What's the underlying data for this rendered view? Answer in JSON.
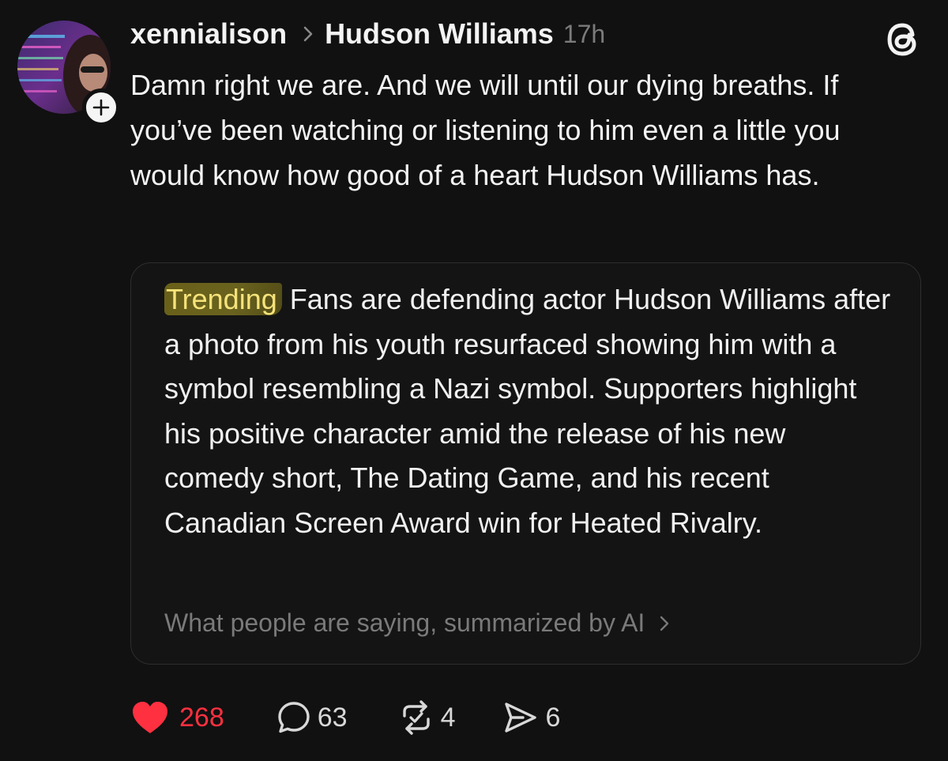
{
  "post": {
    "author": "xennialison",
    "reply_to": "Hudson Williams",
    "timestamp": "17h",
    "body": "Damn right we are. And we will until our dying breaths. If you’ve been watching or listening to him even a little you would know how good of a heart Hudson Williams has."
  },
  "card": {
    "tag": "Trending",
    "summary": "Fans are defending actor Hudson Williams after a photo from his youth resurfaced showing him with a symbol resembling a Nazi symbol. Supporters highlight his positive character amid the release of his new comedy short, The Dating Game, and his recent Canadian Screen Award win for Heated Rivalry.",
    "footer": "What people are saying, summarized by AI"
  },
  "actions": {
    "likes": "268",
    "replies": "63",
    "reposts": "4",
    "shares": "6"
  },
  "colors": {
    "background": "#111111",
    "like_red": "#ff3040",
    "muted_text": "#7b7b7b",
    "highlight_yellow": "#f6e37a"
  },
  "icons": {
    "follow": "plus-icon",
    "brand": "threads-logo-icon",
    "separator": "chevron-right-icon",
    "like": "heart-icon",
    "reply": "comment-bubble-icon",
    "repost": "repost-icon",
    "share": "send-icon"
  }
}
